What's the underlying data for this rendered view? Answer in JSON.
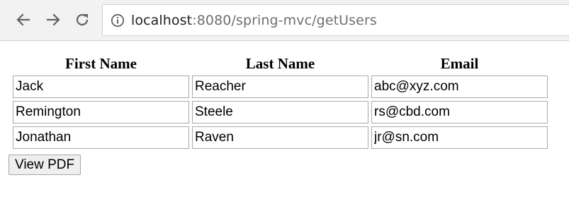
{
  "browser": {
    "back_icon": "arrow-left-icon",
    "forward_icon": "arrow-right-icon",
    "reload_icon": "reload-icon",
    "info_icon": "info-circle-icon",
    "url_host": "localhost",
    "url_path": ":8080/spring-mvc/getUsers"
  },
  "table": {
    "headers": [
      "First Name",
      "Last Name",
      "Email"
    ],
    "rows": [
      [
        "Jack",
        "Reacher",
        "abc@xyz.com"
      ],
      [
        "Remington",
        "Steele",
        "rs@cbd.com"
      ],
      [
        "Jonathan",
        "Raven",
        "jr@sn.com"
      ]
    ]
  },
  "actions": {
    "view_pdf_label": "View PDF"
  }
}
